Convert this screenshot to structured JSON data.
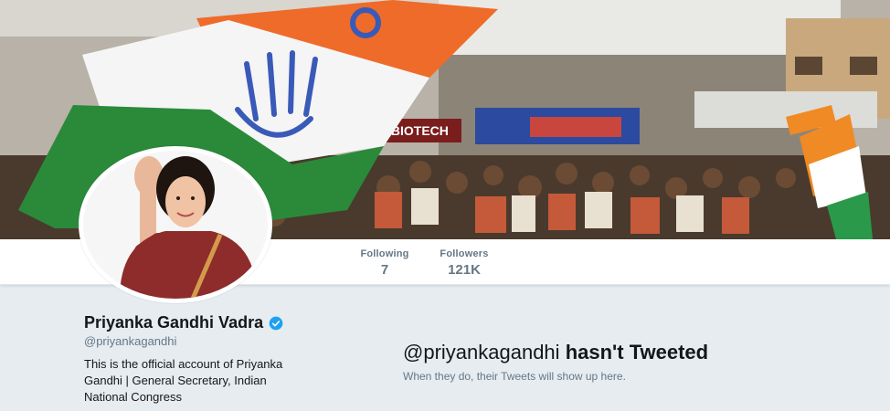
{
  "banner": {
    "description_icon": "flag-crowd-banner"
  },
  "nav": {
    "following_label": "Following",
    "following_value": "7",
    "followers_label": "Followers",
    "followers_value": "121K"
  },
  "profile": {
    "name": "Priyanka Gandhi Vadra",
    "handle": "@priyankagandhi",
    "bio": "This is the official account of Priyanka Gandhi | General Secretary, Indian National Congress",
    "verified_color": "#1da1f2"
  },
  "banner_sign": "HI BIOTECH",
  "empty_state": {
    "handle": "@priyankagandhi",
    "title_rest": "hasn't Tweeted",
    "subtitle": "When they do, their Tweets will show up here."
  },
  "colors": {
    "accent": "#1da1f2",
    "background": "#e6ecf0",
    "muted": "#657786"
  }
}
